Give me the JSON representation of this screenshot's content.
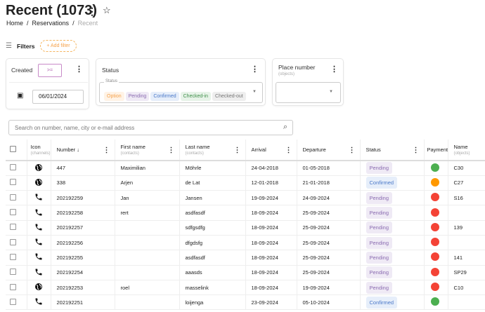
{
  "header": {
    "title": "Recent (1073)",
    "breadcrumb": [
      "Home",
      "Reservations",
      "Recent"
    ]
  },
  "filters": {
    "label": "Filters",
    "add_filter": "+ Add filter",
    "created": {
      "label": "Created",
      "operator": ">=",
      "date": "06/01/2024"
    },
    "status": {
      "label": "Status",
      "field_label": "Status",
      "chips": [
        {
          "label": "Option",
          "bg": "#fff3e6",
          "fg": "#f5a24b"
        },
        {
          "label": "Pending",
          "bg": "#efeaf5",
          "fg": "#8a6bb0"
        },
        {
          "label": "Confirmed",
          "bg": "#e6eefa",
          "fg": "#4a78c8"
        },
        {
          "label": "Checked-in",
          "bg": "#e7f3e8",
          "fg": "#3f8f4a"
        },
        {
          "label": "Checked-out",
          "bg": "#eeeeee",
          "fg": "#777777"
        }
      ]
    },
    "place": {
      "label": "Place number",
      "sub": "(objects)"
    }
  },
  "search": {
    "placeholder": "Search on number, name, city or e-mail address"
  },
  "table": {
    "columns": [
      {
        "label": "Icon",
        "sub": "(channels)"
      },
      {
        "label": "Number ↓"
      },
      {
        "label": "First name",
        "sub": "(contacts)"
      },
      {
        "label": "Last name",
        "sub": "(contacts)"
      },
      {
        "label": "Arrival"
      },
      {
        "label": "Departure"
      },
      {
        "label": "Status"
      },
      {
        "label": "Payment"
      },
      {
        "label": "Name",
        "sub": "(objects)"
      }
    ],
    "rows": [
      {
        "icon": "globe",
        "number": "447",
        "first": "Maximilian",
        "last": "Möhrle",
        "arrival": "24-04-2018",
        "departure": "01-05-2018",
        "status": "Pending",
        "payment": "#4caf50",
        "name": "C30"
      },
      {
        "icon": "globe",
        "number": "338",
        "first": "Arjen",
        "last": "de Lat",
        "arrival": "12-01-2018",
        "departure": "21-01-2018",
        "status": "Confirmed",
        "payment": "#ff9800",
        "name": "C27"
      },
      {
        "icon": "phone",
        "number": "202192259",
        "first": "Jan",
        "last": "Jansen",
        "arrival": "19-09-2024",
        "departure": "24-09-2024",
        "status": "Pending",
        "payment": "#f44336",
        "name": "S16"
      },
      {
        "icon": "phone",
        "number": "202192258",
        "first": "rert",
        "last": "asdfasdf",
        "arrival": "18-09-2024",
        "departure": "25-09-2024",
        "status": "Pending",
        "payment": "#f44336",
        "name": ""
      },
      {
        "icon": "phone",
        "number": "202192257",
        "first": "",
        "last": "sdfgsdfg",
        "arrival": "18-09-2024",
        "departure": "25-09-2024",
        "status": "Pending",
        "payment": "#f44336",
        "name": "139"
      },
      {
        "icon": "phone",
        "number": "202192256",
        "first": "",
        "last": "dfgdsfg",
        "arrival": "18-09-2024",
        "departure": "25-09-2024",
        "status": "Pending",
        "payment": "#f44336",
        "name": ""
      },
      {
        "icon": "phone",
        "number": "202192255",
        "first": "",
        "last": "asdfasdf",
        "arrival": "18-09-2024",
        "departure": "25-09-2024",
        "status": "Pending",
        "payment": "#f44336",
        "name": "141"
      },
      {
        "icon": "phone",
        "number": "202192254",
        "first": "",
        "last": "aaasds",
        "arrival": "18-09-2024",
        "departure": "25-09-2024",
        "status": "Pending",
        "payment": "#f44336",
        "name": "SP29"
      },
      {
        "icon": "globe",
        "number": "202192253",
        "first": "roel",
        "last": "masselink",
        "arrival": "18-09-2024",
        "departure": "19-09-2024",
        "status": "Pending",
        "payment": "#f44336",
        "name": "C10"
      },
      {
        "icon": "phone",
        "number": "202192251",
        "first": "",
        "last": "loijenga",
        "arrival": "23-09-2024",
        "departure": "05-10-2024",
        "status": "Confirmed",
        "payment": "#4caf50",
        "name": ""
      }
    ]
  }
}
